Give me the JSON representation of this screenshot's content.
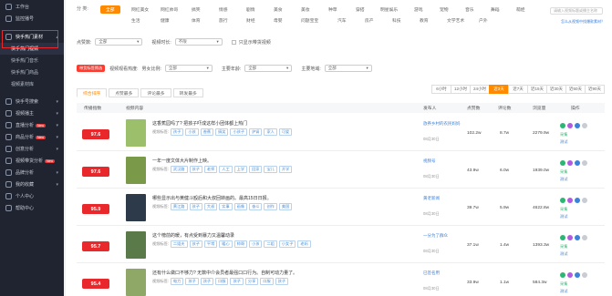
{
  "sidebar": {
    "top": "工作台",
    "top2": "监控播号",
    "section": "快手热门素材",
    "subs": [
      "快手热门视频",
      "快手热门音乐",
      "快手热门商品",
      "视频素材库"
    ],
    "groups": [
      {
        "label": "快手号搜索"
      },
      {
        "label": "视频播主"
      },
      {
        "label": "直播分析",
        "badge": "New"
      },
      {
        "label": "商品分析",
        "badge": "New"
      },
      {
        "label": "创意分析"
      },
      {
        "label": "视频带货分析",
        "badge": "New"
      },
      {
        "label": "品牌分析"
      },
      {
        "label": "我的收藏"
      },
      {
        "label": "个人中心"
      },
      {
        "label": "帮助中心"
      }
    ]
  },
  "categories": {
    "label": "分 类:",
    "items": [
      "全部",
      "网红美女",
      "网红帅哥",
      "搞笑",
      "情感",
      "剧情",
      "美食",
      "美妆",
      "种草",
      "穿搭",
      "明星娱乐",
      "游戏",
      "宠物",
      "音乐",
      "舞蹈",
      "萌娃",
      "生活",
      "健康",
      "体育",
      "旅行",
      "财经",
      "母婴",
      "问题宝宝",
      "汽车",
      "房产",
      "科技",
      "教育",
      "文学艺术",
      "户外"
    ]
  },
  "search": {
    "placeholder": "请输入视频标题或播主名称",
    "tip": "怎么从视频中找爆款素材？"
  },
  "filters": {
    "sort_label": "点赞数:",
    "sort_value": "全部",
    "dur_label": "视频时长:",
    "dur_value": "不限",
    "chk_label": "只显示带货视频"
  },
  "filters2": {
    "pill": "带货标签筛选",
    "a_label": "视频观看热度:",
    "a_value": "男女比例:",
    "b_label": "主要年龄:",
    "b_value": "全部",
    "c_label": "主要地域:",
    "c_value": "全部"
  },
  "tabs": [
    "综合排序",
    "点赞最多",
    "评论最多",
    "转发最多"
  ],
  "range": [
    "6小时",
    "12小时",
    "24小时",
    "近3天",
    "近7天",
    "近15天",
    "近30天",
    "近60天",
    "近90天"
  ],
  "range_active": 3,
  "thead": {
    "score": "传播指数",
    "content": "视频内容",
    "author": "发布人",
    "likes": "点赞数",
    "comments": "评论数",
    "views": "浏览量",
    "ops": "操作"
  },
  "rows": [
    {
      "score": "97.6",
      "title": "这香蕉园吗了? 把孩子吓成这样小团体都上热门",
      "tags_label": "视频标签:",
      "tags": [
        "孩子",
        "小孩",
        "香蕉",
        "搞笑",
        "小孩子",
        "护肾",
        "家人",
        "可爱"
      ],
      "author": "放养乡村的农民妈妈",
      "date": "08月30日",
      "likes": "102.2w",
      "comments": "8.7w",
      "views": "2279.9w",
      "thumb": "#9bbf6a"
    },
    {
      "score": "97.6",
      "title": "一年一度文体大片制作上映。",
      "tags_label": "视频标签:",
      "tags": [
        "武汉路",
        "孩子",
        "老师",
        "人工",
        "上学",
        "回家",
        "宝儿",
        "开学"
      ],
      "author": "视频号",
      "date": "08月30日",
      "likes": "43.9w",
      "comments": "6.0w",
      "views": "1939.0w",
      "thumb": "#7a9a4a"
    },
    {
      "score": "95.9",
      "title": "哪些显示出与黄健斗殴后和大叔回转画的。最高15日日报。",
      "tags_label": "视频标签:",
      "tags": [
        "黄江路",
        "孩子",
        "大叔",
        "实事",
        "画像",
        "奋斗",
        "创作",
        "美国"
      ],
      "author": "黄老新闻",
      "date": "08月30日",
      "likes": "39.7w",
      "comments": "5.9w",
      "views": "4622.8w",
      "thumb": "#2d3a4a"
    },
    {
      "score": "95.7",
      "title": "这个榜前的暖，有点受到暴力又温馨动录",
      "tags_label": "视频标签:",
      "tags": [
        "二姐夫",
        "孩子",
        "平常",
        "暖心",
        "帅哥",
        "小孩",
        "二姐",
        "小女子",
        "老妈"
      ],
      "author": "一分为了群众",
      "date": "08月30日",
      "likes": "37.1w",
      "comments": "1.4w",
      "views": "1393.3w",
      "thumb": "#5a7a4a"
    },
    {
      "score": "95.4",
      "title": "还有什么做口不够力? 无数中介会员者最强口口行为。自制可动力量了。",
      "tags_label": "视频标签:",
      "tags": [
        "电力",
        "孩子",
        "孩子",
        "口服",
        "孩子",
        "分享",
        "口服",
        "孩子"
      ],
      "author": "已签名用",
      "date": "08月30日",
      "likes": "33.9w",
      "comments": "1.1w",
      "views": "584.3w",
      "thumb": "#8fa868"
    }
  ],
  "ops": {
    "green": "采集",
    "blue": "测试"
  }
}
